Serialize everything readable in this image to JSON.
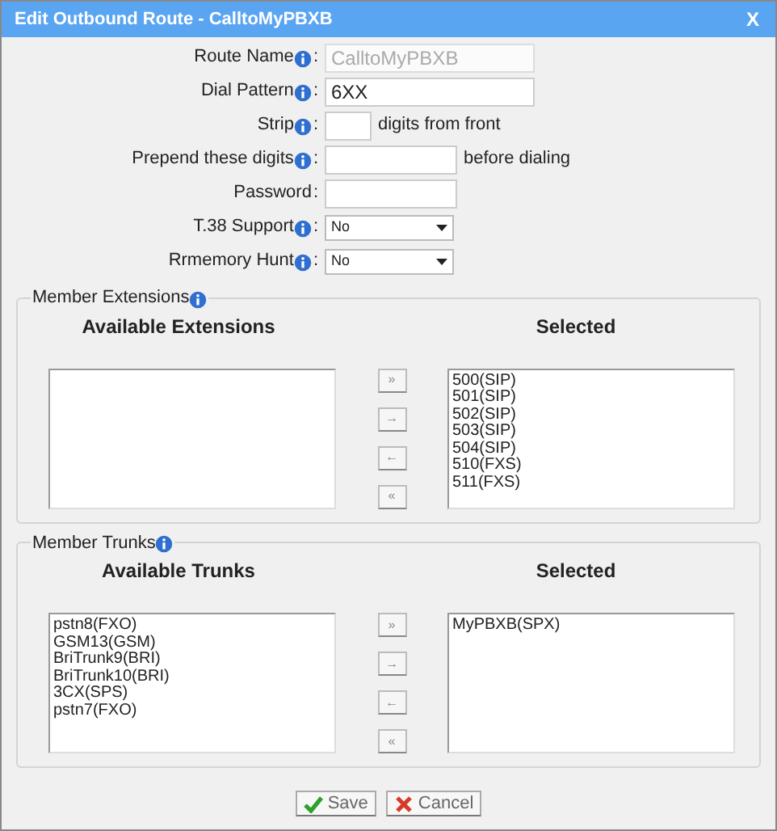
{
  "window": {
    "title": "Edit Outbound Route - CalltoMyPBXB",
    "close": "X"
  },
  "fields": [
    {
      "kind": "text",
      "label": "Route Name",
      "info": true,
      "separator": ":",
      "value": "CalltoMyPBXB",
      "disabled": true
    },
    {
      "kind": "text",
      "label": "Dial Pattern",
      "info": true,
      "separator": ":",
      "value": "6XX",
      "disabled": false
    },
    {
      "kind": "text",
      "label": "Strip",
      "info": true,
      "separator": ":",
      "disabled": false,
      "suffix": "digits from front"
    },
    {
      "kind": "text",
      "label": "Prepend these digits",
      "info": true,
      "separator": ":",
      "disabled": false,
      "suffix": "before dialing"
    },
    {
      "kind": "text",
      "label": "Password",
      "info": false,
      "separator": ":",
      "disabled": false
    },
    {
      "kind": "select",
      "label": "T.38 Support",
      "info": true,
      "separator": ":",
      "value": "No"
    },
    {
      "kind": "select",
      "label": "Rrmemory Hunt",
      "info": true,
      "separator": ":",
      "value": "No"
    }
  ],
  "groups": [
    {
      "legend": "Member Extensions",
      "available_heading": "Available Extensions",
      "selected_heading": "Selected",
      "selected": [
        "500(SIP)",
        "501(SIP)",
        "502(SIP)",
        "503(SIP)",
        "504(SIP)",
        "510(FXS)",
        "511(FXS)"
      ],
      "move_buttons": [
        "»",
        "→",
        "←",
        "«"
      ]
    },
    {
      "legend": "Member Trunks",
      "available_heading": "Available Trunks",
      "selected_heading": "Selected",
      "available": [
        "pstn8(FXO)",
        "GSM13(GSM)",
        "BriTrunk9(BRI)",
        "BriTrunk10(BRI)",
        "3CX(SPS)",
        "pstn7(FXO)"
      ],
      "selected": [
        "MyPBXB(SPX)"
      ],
      "move_buttons": [
        "»",
        "→",
        "←",
        "«"
      ]
    }
  ],
  "buttons": [
    {
      "kind": "save",
      "label": "Save"
    },
    {
      "kind": "cancel",
      "label": "Cancel"
    }
  ]
}
